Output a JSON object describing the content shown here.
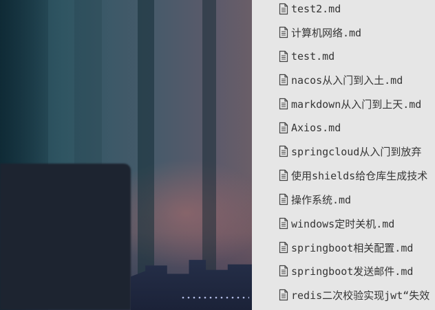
{
  "file_tree": {
    "items": [
      {
        "label": "test2.md",
        "icon": "file-text-icon"
      },
      {
        "label": "计算机网络.md",
        "icon": "file-text-icon"
      },
      {
        "label": "test.md",
        "icon": "file-text-icon"
      },
      {
        "label": "nacos从入门到入土.md",
        "icon": "file-text-icon"
      },
      {
        "label": "markdown从入门到上天.md",
        "icon": "file-text-icon"
      },
      {
        "label": "Axios.md",
        "icon": "file-text-icon"
      },
      {
        "label": "springcloud从入门到放弃",
        "icon": "file-text-icon"
      },
      {
        "label": "使用shields给仓库生成技术",
        "icon": "file-text-icon"
      },
      {
        "label": "操作系统.md",
        "icon": "file-text-icon"
      },
      {
        "label": "windows定时关机.md",
        "icon": "file-text-icon"
      },
      {
        "label": "springboot相关配置.md",
        "icon": "file-text-icon"
      },
      {
        "label": "springboot发送邮件.md",
        "icon": "file-text-icon"
      },
      {
        "label": "redis二次校验实现jwt“失效",
        "icon": "file-text-icon"
      }
    ]
  },
  "colors": {
    "panel_background": "#e6e6e6",
    "item_text": "#353535"
  }
}
